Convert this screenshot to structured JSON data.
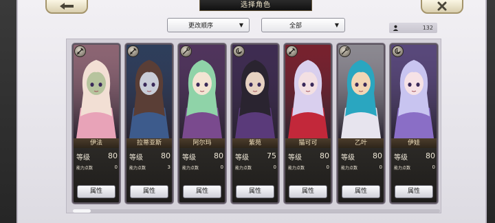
{
  "header": {
    "title": "选择角色"
  },
  "toolbar": {
    "sort_label": "更改顺序",
    "filter_label": "全部",
    "dropdown_arrow": "▼",
    "owned_count": "132"
  },
  "labels": {
    "level": "等级",
    "points": "能力点数",
    "attr_button": "属性"
  },
  "characters": [
    {
      "name": "伊法",
      "level": "80",
      "points": "0",
      "role": "sword",
      "palette": [
        "#f2dfd4",
        "#b7c49e",
        "#e8a3b8"
      ]
    },
    {
      "name": "拉蒂亚斯",
      "level": "80",
      "points": "3",
      "role": "sword",
      "palette": [
        "#5a3e36",
        "#c9cdd8",
        "#3d5b8c"
      ]
    },
    {
      "name": "阿尔玛",
      "level": "80",
      "points": "0",
      "role": "staff",
      "palette": [
        "#8fd3a8",
        "#f3e4d3",
        "#7a4a8e"
      ]
    },
    {
      "name": "紫苑",
      "level": "75",
      "points": "0",
      "role": "magic",
      "palette": [
        "#2a2430",
        "#e7d2c2",
        "#5a3a7a"
      ]
    },
    {
      "name": "猫可可",
      "level": "80",
      "points": "0",
      "role": "sword",
      "palette": [
        "#d9cfee",
        "#f3e0e3",
        "#c2283a"
      ]
    },
    {
      "name": "乙叶",
      "level": "80",
      "points": "0",
      "role": "staff",
      "palette": [
        "#2aa6c0",
        "#f2d6b5",
        "#e7e4ee"
      ]
    },
    {
      "name": "伊娃",
      "level": "80",
      "points": "0",
      "role": "magic",
      "palette": [
        "#c8c4f0",
        "#f6e2e6",
        "#8a6ec6"
      ]
    }
  ],
  "colors": {
    "card_border": "#5d5560",
    "name_text": "#f2e2bf",
    "panel_bg": "#ece9ef"
  },
  "icons": {
    "back": "arrow-left-icon",
    "close": "close-x-icon",
    "count": "person-icon"
  },
  "scroll": {
    "position": 0
  }
}
